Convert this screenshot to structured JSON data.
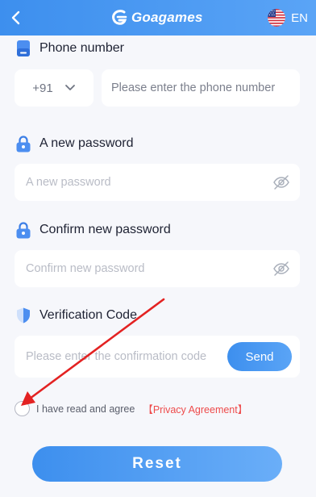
{
  "header": {
    "brand": "Goagames",
    "language": "EN",
    "back_icon": "chevron-left-icon",
    "flag_icon": "us-flag-icon"
  },
  "form": {
    "phone": {
      "label": "Phone number",
      "icon": "phone-icon",
      "country_code": "+91",
      "placeholder": "Please enter the phone number"
    },
    "new_password": {
      "label": "A new password",
      "icon": "lock-icon",
      "placeholder": "A new password"
    },
    "confirm_password": {
      "label": "Confirm new password",
      "icon": "lock-icon",
      "placeholder": "Confirm new password"
    },
    "verification": {
      "label": "Verification Code",
      "icon": "shield-icon",
      "placeholder": "Please enter the confirmation code",
      "send_label": "Send"
    }
  },
  "agreement": {
    "text": "I have read and agree",
    "link": "【Privacy Agreement】"
  },
  "reset_label": "Reset",
  "colors": {
    "accent": "#3d8fee",
    "link": "#ee4b4b",
    "background": "#f6f7fb"
  }
}
